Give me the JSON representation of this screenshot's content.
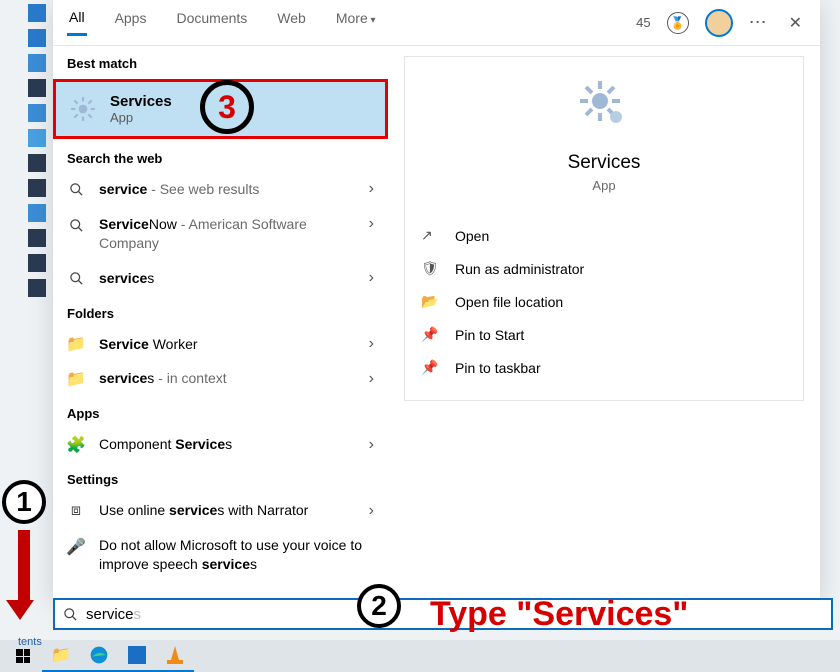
{
  "tabs": {
    "all": "All",
    "apps": "Apps",
    "documents": "Documents",
    "web": "Web",
    "more": "More"
  },
  "topright": {
    "points": "45"
  },
  "sections": {
    "best": "Best match",
    "web": "Search the web",
    "folders": "Folders",
    "apps": "Apps",
    "settings": "Settings"
  },
  "best_match": {
    "title": "Services",
    "sub": "App"
  },
  "web_results": [
    {
      "term_bold": "service",
      "suffix": "",
      "hint": " - See web results"
    },
    {
      "term_bold": "Service",
      "suffix": "Now",
      "hint": " - American Software Company"
    },
    {
      "term_bold": "service",
      "suffix": "s",
      "hint": ""
    }
  ],
  "folders": [
    {
      "bold": "Service",
      "suffix": " Worker"
    },
    {
      "bold": "service",
      "suffix": "s",
      "hint": " - in context"
    }
  ],
  "apps_list": [
    {
      "pre": "Component ",
      "bold": "Service",
      "post": "s"
    }
  ],
  "settings_list": [
    {
      "text_pre": "Use online ",
      "bold": "service",
      "text_post": "s with Narrator"
    },
    {
      "text_pre": "Do not allow Microsoft to use your voice to improve speech ",
      "bold": "service",
      "text_post": "s"
    }
  ],
  "detail": {
    "title": "Services",
    "category": "App",
    "actions": {
      "open": "Open",
      "admin": "Run as administrator",
      "loc": "Open file location",
      "pin_start": "Pin to Start",
      "pin_tb": "Pin to taskbar"
    }
  },
  "search": {
    "typed": "service",
    "ghost": "s"
  },
  "annotations": {
    "one": "1",
    "two": "2",
    "three": "3",
    "type_hint": "Type \"Services\""
  },
  "desktop_label": "tents"
}
